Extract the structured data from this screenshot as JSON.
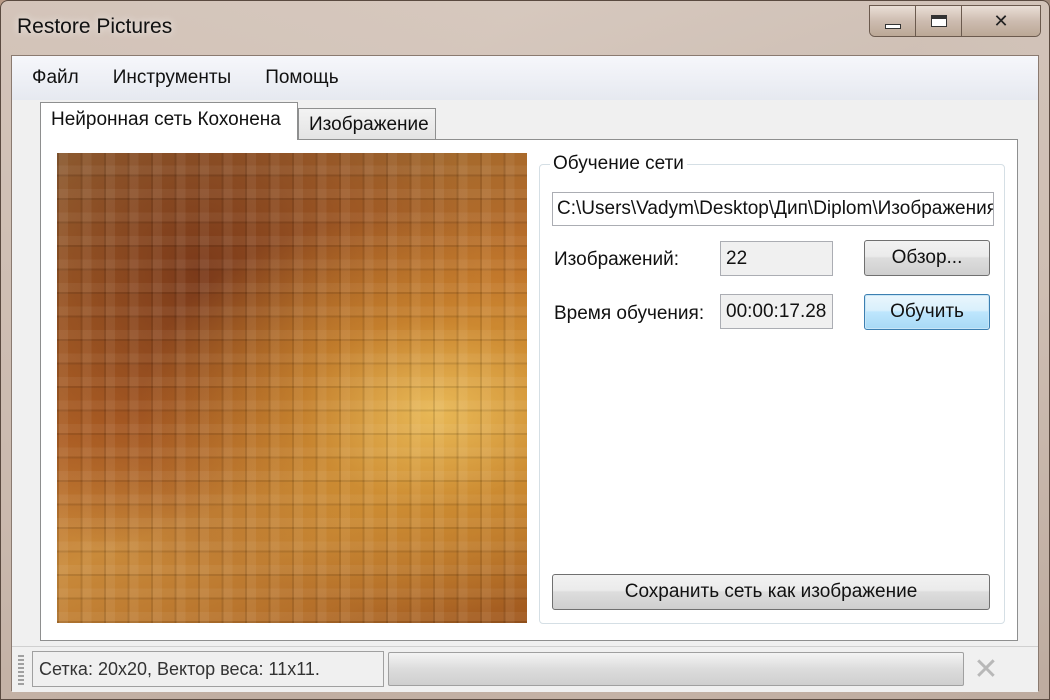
{
  "window": {
    "title": "Restore Pictures",
    "close_glyph": "✕"
  },
  "menu": {
    "items": [
      "Файл",
      "Инструменты",
      "Помощь"
    ]
  },
  "tabs": [
    {
      "label": "Нейронная сеть Кохонена",
      "active": true
    },
    {
      "label": "Изображение",
      "active": false
    }
  ],
  "training": {
    "group_title": "Обучение сети",
    "path_value": "C:\\Users\\Vadym\\Desktop\\Дип\\Diplom\\Изображения",
    "images_label": "Изображений:",
    "images_count": "22",
    "browse_button": "Обзор...",
    "time_label": "Время обучения:",
    "time_value": "00:00:17.28",
    "train_button": "Обучить",
    "save_button": "Сохранить сеть как изображение"
  },
  "status": {
    "text": "Сетка: 20x20, Вектор веса: 11x11.",
    "progress": 0,
    "cancel_icon": "cancel-icon"
  },
  "colors": {
    "accent_focus": "#3c7fb1",
    "panel_bg": "#ffffff",
    "client_bg": "#f0f0f0"
  }
}
